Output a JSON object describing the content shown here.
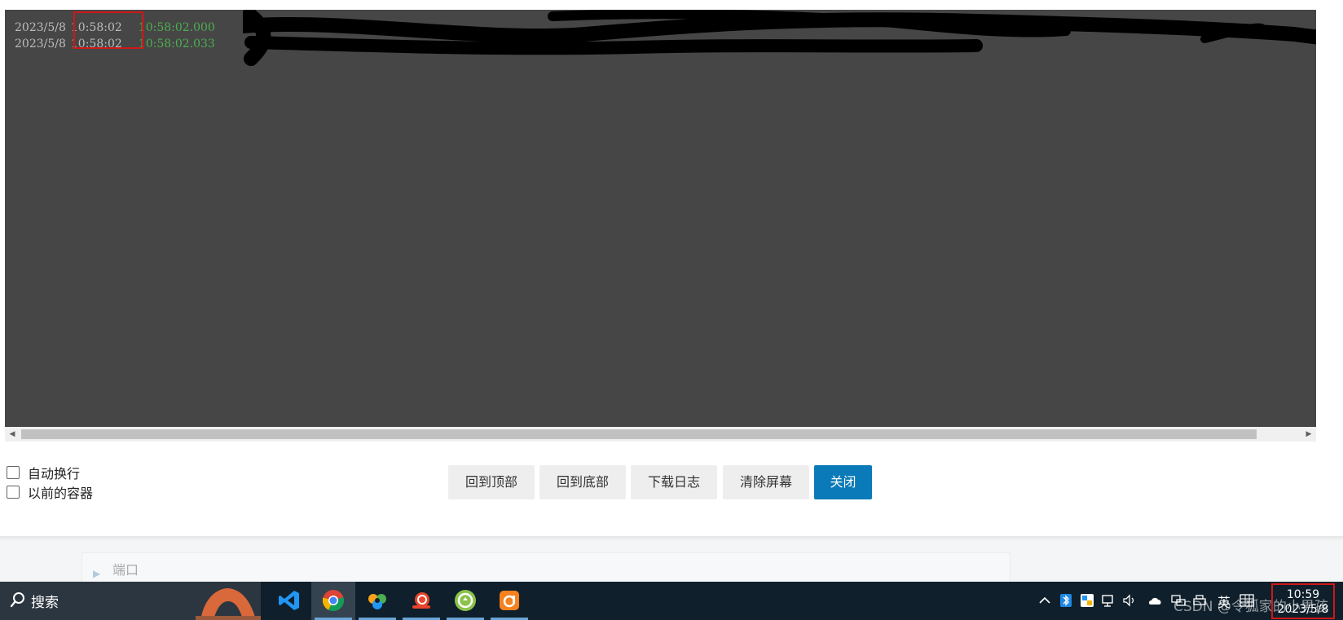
{
  "log": {
    "lines": [
      {
        "date": "2023/5/8",
        "time": "10:58:02",
        "stamp": "10:58:02.000"
      },
      {
        "date": "2023/5/8",
        "time": "10:58:02",
        "stamp": "10:58:02.033"
      }
    ]
  },
  "options": {
    "auto_wrap": "自动换行",
    "previous_container": "以前的容器"
  },
  "buttons": {
    "back_to_top": "回到顶部",
    "back_to_bottom": "回到底部",
    "download_log": "下载日志",
    "clear_screen": "清除屏幕",
    "close": "关闭"
  },
  "background_page": {
    "section_label": "端口"
  },
  "taskbar": {
    "search_label": "搜索",
    "apps": [
      "vscode-icon",
      "chrome-icon",
      "navicat-icon",
      "snail-app-icon",
      "green-cloud-icon",
      "orange-app-icon"
    ],
    "ime_label": "英",
    "clock_time": "10:59",
    "clock_date": "2023/5/8"
  },
  "watermark": "CSDN @令狐家的小男孩",
  "colors": {
    "console_bg": "#464646",
    "log_text": "#bdbdbd",
    "log_stamp": "#4caf50",
    "highlight_box": "#d01717",
    "primary_button": "#0a7ab8",
    "taskbar_bg": "#0f1f2b"
  }
}
